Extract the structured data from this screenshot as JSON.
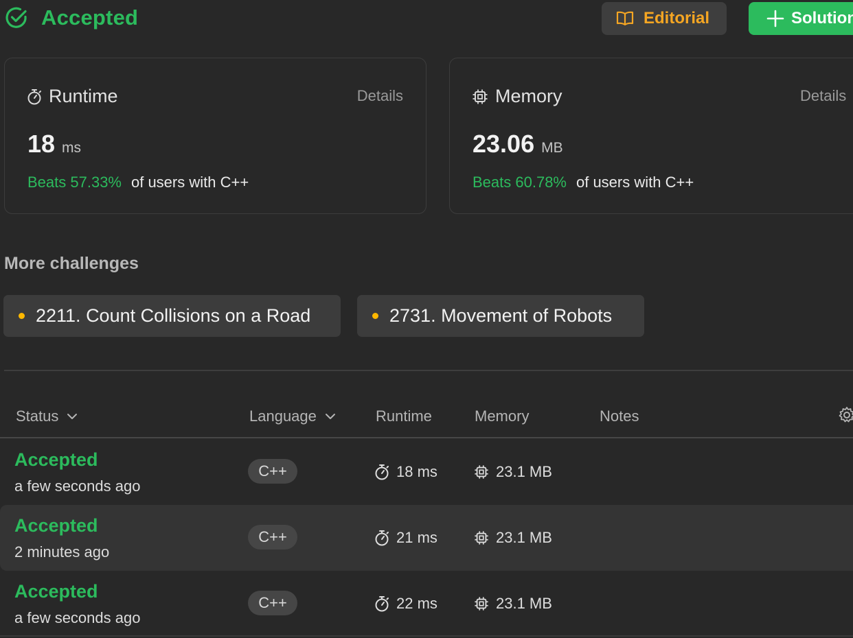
{
  "header": {
    "status": "Accepted",
    "editorial_label": "Editorial",
    "solution_label": "Solution"
  },
  "runtime_card": {
    "title": "Runtime",
    "details": "Details",
    "value": "18",
    "unit": "ms",
    "beats": "Beats 57.33%",
    "beats_rest": "of users with C++"
  },
  "memory_card": {
    "title": "Memory",
    "details": "Details",
    "value": "23.06",
    "unit": "MB",
    "beats": "Beats 60.78%",
    "beats_rest": "of users with C++"
  },
  "more_challenges": {
    "title": "More challenges",
    "items": [
      {
        "label": "2211. Count Collisions on a Road"
      },
      {
        "label": "2731. Movement of Robots"
      }
    ]
  },
  "table": {
    "headers": {
      "status": "Status",
      "language": "Language",
      "runtime": "Runtime",
      "memory": "Memory",
      "notes": "Notes"
    },
    "rows": [
      {
        "status": "Accepted",
        "time_ago": "a few seconds ago",
        "language": "C++",
        "runtime": "18 ms",
        "memory": "23.1 MB"
      },
      {
        "status": "Accepted",
        "time_ago": "2 minutes ago",
        "language": "C++",
        "runtime": "21 ms",
        "memory": "23.1 MB"
      },
      {
        "status": "Accepted",
        "time_ago": "a few seconds ago",
        "language": "C++",
        "runtime": "22 ms",
        "memory": "23.1 MB"
      }
    ]
  },
  "colors": {
    "accepted_green": "#2cbb5d",
    "editorial_orange": "#f5a623",
    "difficulty_dot": "#ffb800",
    "background": "#282828"
  },
  "icons": {
    "status": "check-circle-icon",
    "editorial": "book-open-icon",
    "solution": "plus-icon",
    "runtime": "stopwatch-icon",
    "memory": "cpu-chip-icon",
    "dropdown": "chevron-down-icon",
    "settings": "gear-icon"
  }
}
